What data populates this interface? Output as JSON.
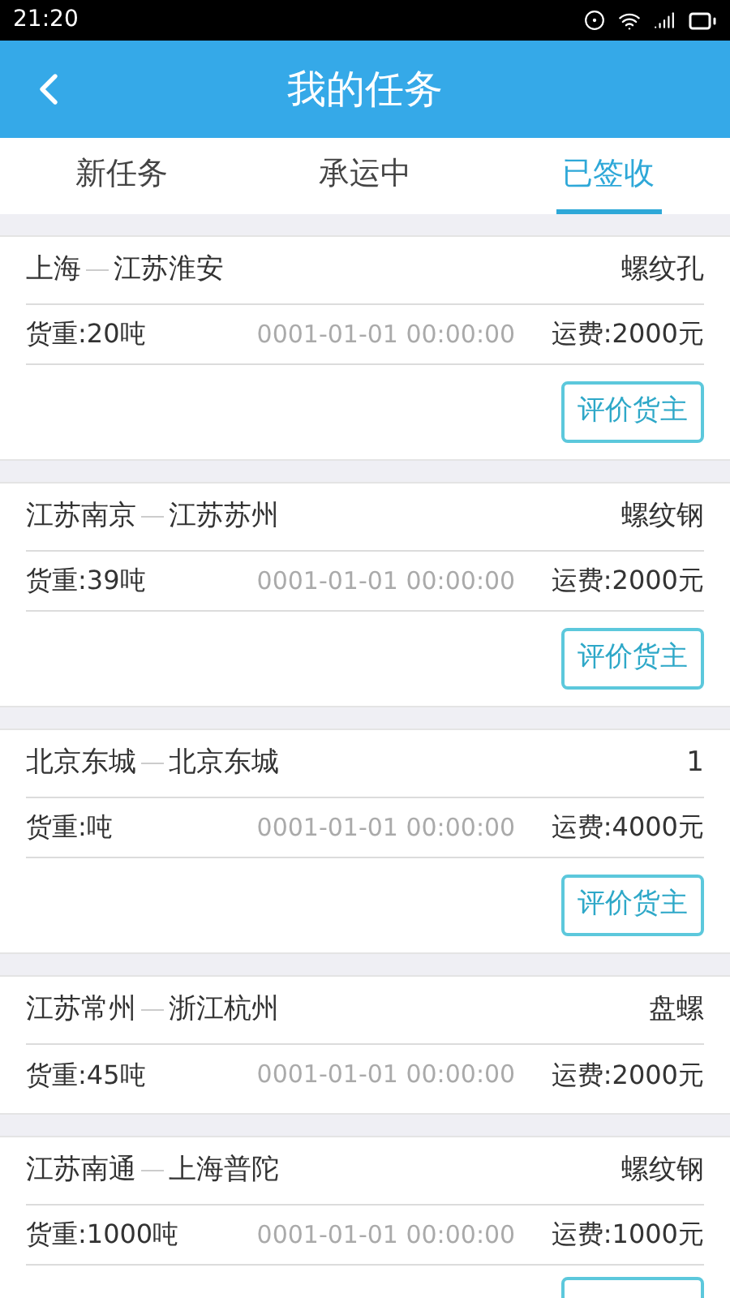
{
  "status_bar": {
    "time": "21:20"
  },
  "header": {
    "title": "我的任务"
  },
  "tabs": [
    {
      "label": "新任务",
      "selected": false
    },
    {
      "label": "承运中",
      "selected": false
    },
    {
      "label": "已签收",
      "selected": true
    }
  ],
  "cards": [
    {
      "origin": "上海",
      "destination": "江苏淮安",
      "cargo": "螺纹孔",
      "weight": "货重:20吨",
      "date": "0001-01-01 00:00:00",
      "fee": "运费:2000元",
      "button": {
        "kind": "labeled",
        "label": "评价货主"
      }
    },
    {
      "origin": "江苏南京",
      "destination": "江苏苏州",
      "cargo": "螺纹钢",
      "weight": "货重:39吨",
      "date": "0001-01-01 00:00:00",
      "fee": "运费:2000元",
      "button": {
        "kind": "labeled",
        "label": "评价货主"
      }
    },
    {
      "origin": "北京东城",
      "destination": "北京东城",
      "cargo": "1",
      "weight": "货重:吨",
      "date": "0001-01-01 00:00:00",
      "fee": "运费:4000元",
      "button": {
        "kind": "labeled",
        "label": "评价货主"
      }
    },
    {
      "origin": "江苏常州",
      "destination": "浙江杭州",
      "cargo": "盘螺",
      "weight": "货重:45吨",
      "date": "0001-01-01 00:00:00",
      "fee": "运费:2000元"
    },
    {
      "origin": "江苏南通",
      "destination": "上海普陀",
      "cargo": "螺纹钢",
      "weight": "货重:1000吨",
      "date": "0001-01-01 00:00:00",
      "fee": "运费:1000元",
      "button": {
        "kind": "cut"
      }
    }
  ]
}
